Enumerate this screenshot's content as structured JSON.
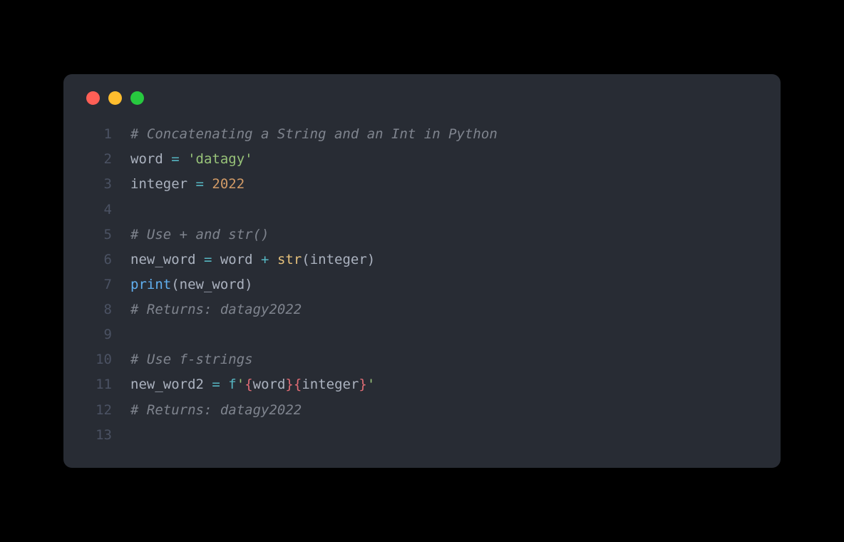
{
  "traffic_lights": {
    "red": "#ff5f56",
    "yellow": "#ffbd2e",
    "green": "#27c93f"
  },
  "line_numbers": {
    "l1": "1",
    "l2": "2",
    "l3": "3",
    "l4": "4",
    "l5": "5",
    "l6": "6",
    "l7": "7",
    "l8": "8",
    "l9": "9",
    "l10": "10",
    "l11": "11",
    "l12": "12",
    "l13": "13"
  },
  "code": {
    "l1": {
      "comment": "# Concatenating a String and an Int in Python"
    },
    "l2": {
      "var": "word ",
      "eq": "=",
      "sp": " ",
      "str": "'datagy'"
    },
    "l3": {
      "var": "integer ",
      "eq": "=",
      "sp": " ",
      "num": "2022"
    },
    "l5": {
      "comment": "# Use + and str()"
    },
    "l6": {
      "var": "new_word ",
      "eq": "=",
      "mid": " word ",
      "plus": "+",
      "sp": " ",
      "strfn": "str",
      "open": "(",
      "arg": "integer",
      "close": ")"
    },
    "l7": {
      "printfn": "print",
      "open": "(",
      "arg": "new_word",
      "close": ")"
    },
    "l8": {
      "comment": "# Returns: datagy2022"
    },
    "l10": {
      "comment": "# Use f-strings"
    },
    "l11": {
      "var": "new_word2 ",
      "eq": "=",
      "sp": " ",
      "fprefix": "f",
      "q1": "'",
      "ob1": "{",
      "w": "word",
      "cb1": "}",
      "ob2": "{",
      "i": "integer",
      "cb2": "}",
      "q2": "'"
    },
    "l12": {
      "comment": "# Returns: datagy2022"
    }
  }
}
